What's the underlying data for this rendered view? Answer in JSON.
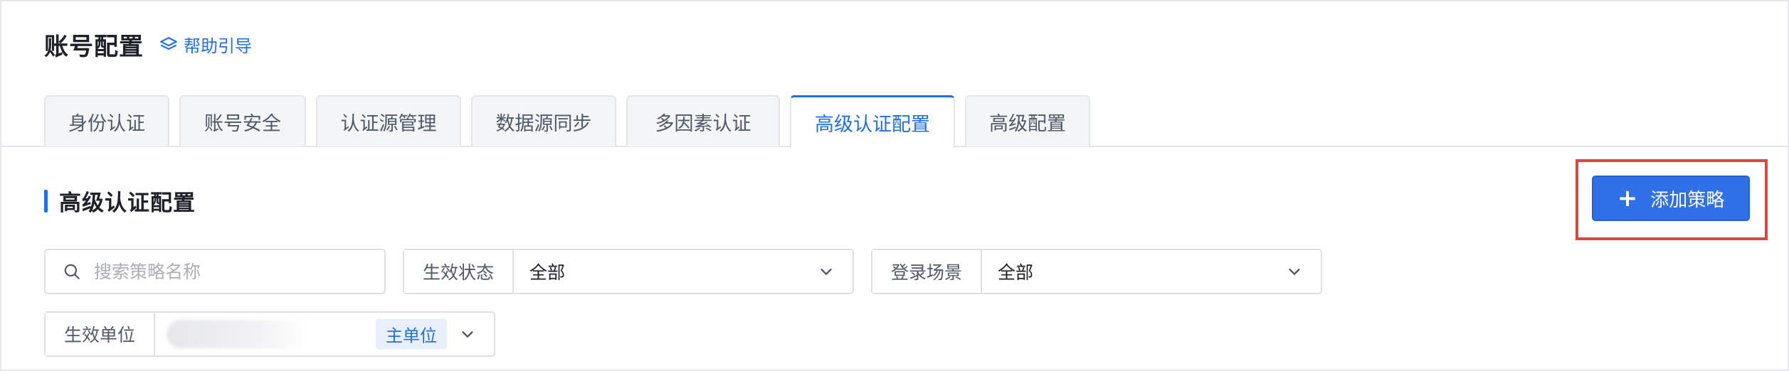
{
  "header": {
    "title": "账号配置",
    "help_label": "帮助引导"
  },
  "tabs": [
    {
      "label": "身份认证",
      "active": false
    },
    {
      "label": "账号安全",
      "active": false
    },
    {
      "label": "认证源管理",
      "active": false
    },
    {
      "label": "数据源同步",
      "active": false
    },
    {
      "label": "多因素认证",
      "active": false
    },
    {
      "label": "高级认证配置",
      "active": true
    },
    {
      "label": "高级配置",
      "active": false
    }
  ],
  "section": {
    "title": "高级认证配置"
  },
  "toolbar": {
    "add_label": "添加策略"
  },
  "filters": {
    "search_placeholder": "搜索策略名称",
    "status": {
      "label": "生效状态",
      "value": "全部"
    },
    "scene": {
      "label": "登录场景",
      "value": "全部"
    },
    "unit": {
      "label": "生效单位",
      "tag": "主单位"
    }
  },
  "colors": {
    "accent": "#1f6fe5",
    "highlight_border": "#d9473d"
  }
}
